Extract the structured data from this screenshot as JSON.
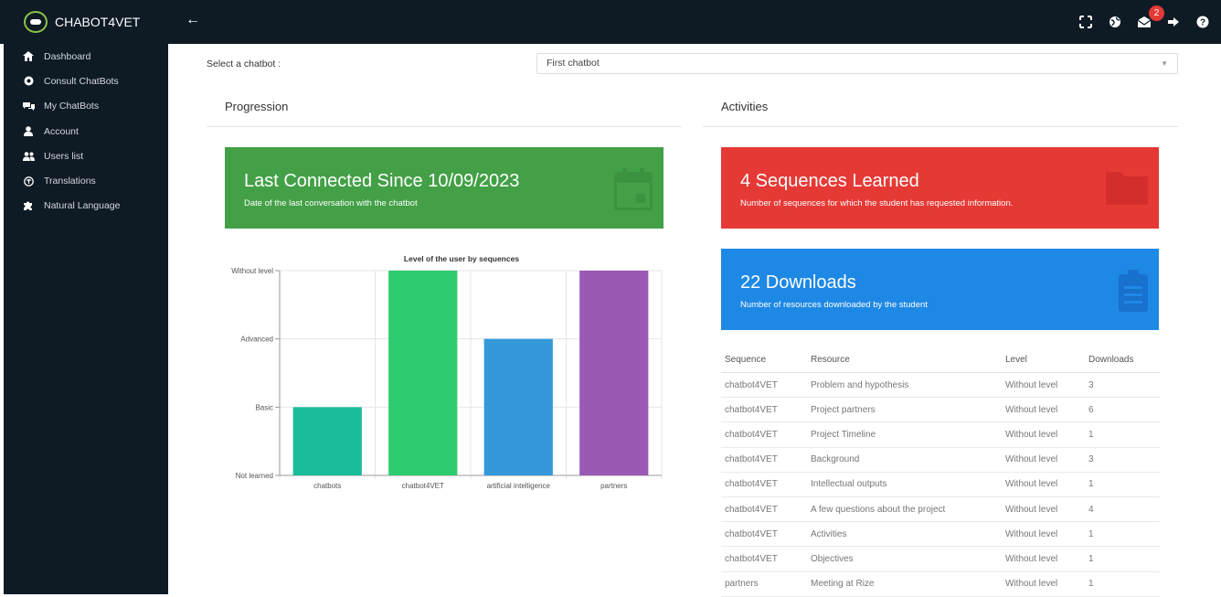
{
  "app": {
    "name": "CHABOT4VET"
  },
  "topbar": {
    "icons": [
      "fullscreen-icon",
      "globe-icon",
      "envelope-icon",
      "logout-icon",
      "help-icon"
    ],
    "notification_count": "2"
  },
  "sidebar": {
    "items": [
      {
        "label": "Dashboard",
        "icon": "home-icon"
      },
      {
        "label": "Consult ChatBots",
        "icon": "globe-icon"
      },
      {
        "label": "My ChatBots",
        "icon": "comments-icon"
      },
      {
        "label": "Account",
        "icon": "user-icon"
      },
      {
        "label": "Users list",
        "icon": "users-icon"
      },
      {
        "label": "Translations",
        "icon": "language-icon"
      },
      {
        "label": "Natural Language",
        "icon": "puzzle-icon"
      }
    ]
  },
  "selector": {
    "label": "Select a chatbot :",
    "value": "First chatbot"
  },
  "progression": {
    "title": "Progression",
    "card": {
      "title": "Last Connected Since 10/09/2023",
      "subtitle": "Date of the last conversation with the chatbot",
      "color": "#43a047",
      "icon": "calendar-icon"
    }
  },
  "activities": {
    "title": "Activities",
    "cards": [
      {
        "title": "4 Sequences Learned",
        "subtitle": "Number of sequences for which the student has requested information.",
        "color": "#e53935",
        "icon": "folder-icon"
      },
      {
        "title": "22 Downloads",
        "subtitle": "Number of resources downloaded by the student",
        "color": "#1e88e5",
        "icon": "clipboard-icon"
      }
    ],
    "table": {
      "headers": [
        "Sequence",
        "Resource",
        "Level",
        "Downloads"
      ],
      "rows": [
        [
          "chatbot4VET",
          "Problem and hypothesis",
          "Without level",
          "3"
        ],
        [
          "chatbot4VET",
          "Project partners",
          "Without level",
          "6"
        ],
        [
          "chatbot4VET",
          "Project Timeline",
          "Without level",
          "1"
        ],
        [
          "chatbot4VET",
          "Background",
          "Without level",
          "3"
        ],
        [
          "chatbot4VET",
          "Intellectual outputs",
          "Without level",
          "1"
        ],
        [
          "chatbot4VET",
          "A few questions about the project",
          "Without level",
          "4"
        ],
        [
          "chatbot4VET",
          "Activities",
          "Without level",
          "1"
        ],
        [
          "chatbot4VET",
          "Objectives",
          "Without level",
          "1"
        ],
        [
          "partners",
          "Meeting at Rize",
          "Without level",
          "1"
        ]
      ]
    }
  },
  "chart_data": {
    "type": "bar",
    "title": "Level of the user by sequences",
    "categories": [
      "chatbots",
      "chatbot4VET",
      "artificial intelligence",
      "partners"
    ],
    "y_levels": [
      "Not learned",
      "Basic",
      "Advanced",
      "Without level"
    ],
    "values": [
      1,
      3,
      2,
      3
    ],
    "ylim": [
      0,
      3
    ],
    "grid": true,
    "colors": [
      "#1abc9c",
      "#2ecc71",
      "#3498db",
      "#9b59b6"
    ]
  }
}
